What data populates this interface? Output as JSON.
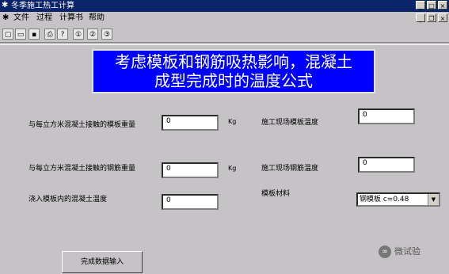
{
  "window": {
    "title": "冬季施工热工计算"
  },
  "menu": {
    "items": [
      "文件",
      "过程",
      "计算书",
      "帮助"
    ]
  },
  "toolbar": {
    "icons": [
      "new-icon",
      "open-icon",
      "save-icon",
      "print-icon",
      "help-icon",
      "circle-1-icon",
      "circle-2-icon",
      "circle-3-icon"
    ]
  },
  "banner": {
    "line1": "考虑模板和钢筋吸热影响，混凝土",
    "line2": "成型完成时的温度公式"
  },
  "fields": {
    "formwork_weight": {
      "label": "与每立方米混凝土接触的模板重量",
      "value": "0",
      "unit": "Kg"
    },
    "rebar_weight": {
      "label": "与每立方米混凝土接触的钢筋重量",
      "value": "0",
      "unit": "Kg"
    },
    "concrete_temp": {
      "label": "浇入模板内的混凝土温度",
      "value": "0"
    },
    "site_formwork_temp": {
      "label": "施工现场模板温度",
      "value": "0"
    },
    "site_rebar_temp": {
      "label": "施工现场钢筋温度",
      "value": "0"
    },
    "formwork_material": {
      "label": "模板材料",
      "value": "钢模板    c=0.48"
    }
  },
  "submit": {
    "label": "完成数据输入"
  },
  "watermark": {
    "text": "微试验"
  }
}
